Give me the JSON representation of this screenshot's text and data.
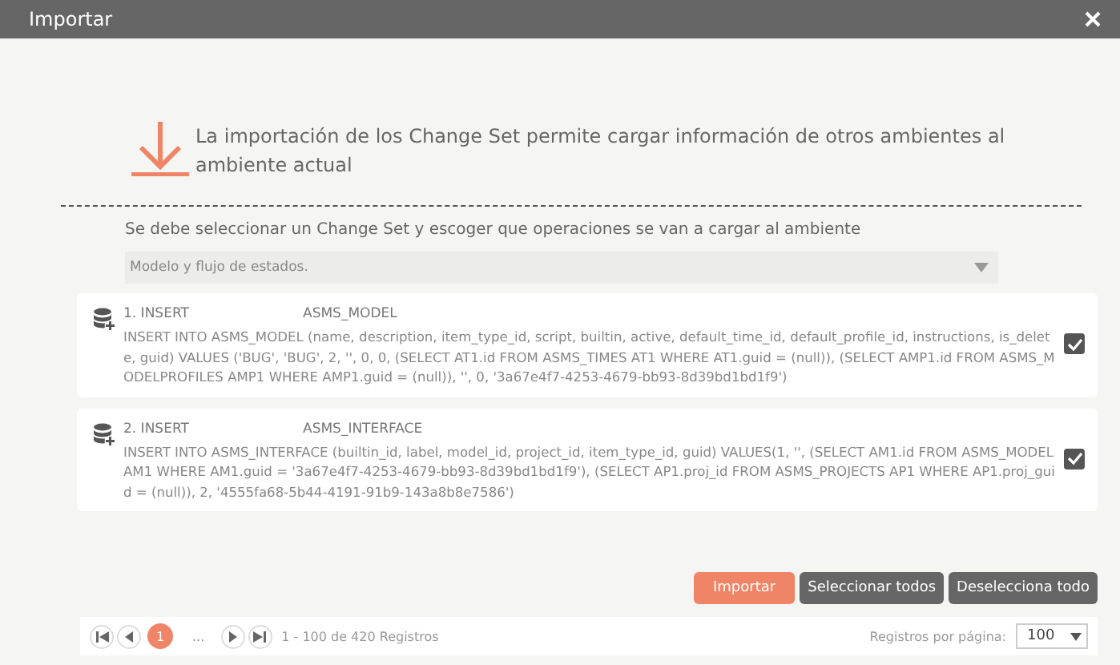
{
  "window": {
    "title": "Importar"
  },
  "intro": "La importación de los Change Set permite cargar información de otros ambientes al ambiente actual",
  "instruction": "Se debe seleccionar un Change Set y escoger que operaciones se van a cargar al ambiente",
  "changeset_select": {
    "value": "Modelo y flujo de estados."
  },
  "operations": [
    {
      "label": "1. INSERT",
      "table": "ASMS_MODEL",
      "sql": "INSERT INTO ASMS_MODEL (name, description, item_type_id, script, builtin, active, default_time_id, default_profile_id, instructions, is_delete, guid) VALUES ('BUG', 'BUG', 2, '', 0, 0, (SELECT AT1.id FROM ASMS_TIMES AT1 WHERE AT1.guid = (null)), (SELECT AMP1.id FROM ASMS_MODELPROFILES AMP1 WHERE AMP1.guid = (null)), '', 0, '3a67e4f7-4253-4679-bb93-8d39bd1bd1f9')",
      "checked": true
    },
    {
      "label": "2. INSERT",
      "table": "ASMS_INTERFACE",
      "sql": "INSERT INTO ASMS_INTERFACE (builtin_id, label, model_id, project_id, item_type_id, guid) VALUES(1, '', (SELECT AM1.id FROM ASMS_MODEL AM1 WHERE AM1.guid = '3a67e4f7-4253-4679-bb93-8d39bd1bd1f9'), (SELECT AP1.proj_id FROM ASMS_PROJECTS AP1 WHERE AP1.proj_guid = (null)), 2, '4555fa68-5b44-4191-91b9-143a8b8e7586')",
      "checked": true
    }
  ],
  "buttons": [
    {
      "label": "Importar",
      "kind": "primary"
    },
    {
      "label": "Seleccionar todos",
      "kind": "secondary"
    },
    {
      "label": "Deselecciona todo",
      "kind": "secondary"
    }
  ],
  "pager": {
    "pages": [
      {
        "label": "1",
        "selected": true
      }
    ],
    "ellipsis": "...",
    "summary": "1 - 100 de 420 Registros",
    "per_page_label": "Registros por página:",
    "per_page": "100"
  }
}
